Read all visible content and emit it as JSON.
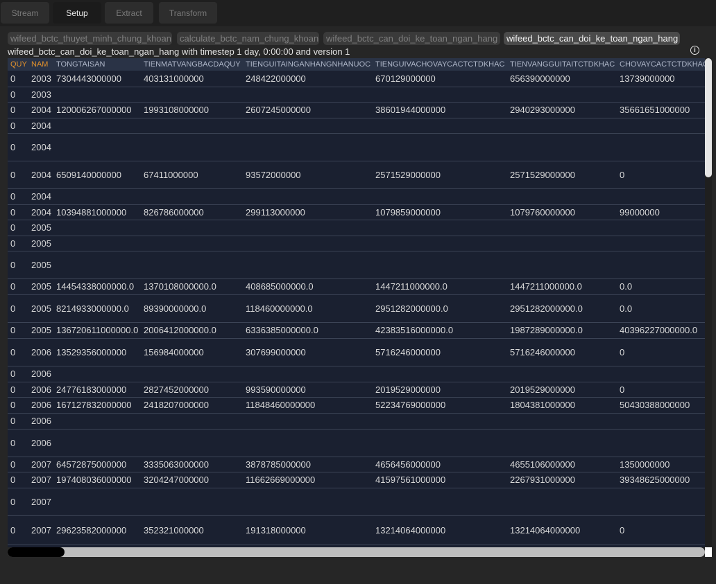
{
  "tabs": [
    "Stream",
    "Setup",
    "Extract",
    "Transform"
  ],
  "active_tab": "Setup",
  "chips": [
    "wifeed_bctc_thuyet_minh_chung_khoan",
    "calculate_bctc_nam_chung_khoan",
    "wifeed_bctc_can_doi_ke_toan_ngan_hang",
    "wifeed_bctc_can_doi_ke_toan_ngan_hang"
  ],
  "subtitle": "wifeed_bctc_can_doi_ke_toan_ngan_hang with timestep 1 day, 0:00:00 and version 1",
  "info_icon": "info-icon",
  "table": {
    "columns": [
      "QUY",
      "NAM",
      "TONGTAISAN",
      "TIENMATVANGBACDAQUY",
      "TIENGUITAINGANHANGNHANUOC",
      "TIENGUIVACHOVAYCACTCTDKHAC",
      "TIENVANGGUITAITCTDKHAC",
      "CHOVAYCACTCTDKHAC"
    ],
    "highlight_columns": [
      "QUY",
      "NAM"
    ],
    "rows": [
      [
        "0",
        "2003",
        "7304443000000",
        "403131000000",
        "248422000000",
        "670129000000",
        "656390000000",
        "13739000000"
      ],
      [
        "0",
        "2003",
        "",
        "",
        "",
        "",
        "",
        ""
      ],
      [
        "0",
        "2004",
        "120006267000000",
        "1993108000000",
        "2607245000000",
        "38601944000000",
        "2940293000000",
        "35661651000000"
      ],
      [
        "0",
        "2004",
        "",
        "",
        "",
        "",
        "",
        ""
      ],
      [
        "0",
        "2004",
        "",
        "",
        "",
        "",
        "",
        ""
      ],
      [
        "0",
        "2004",
        "6509140000000",
        "67411000000",
        "93572000000",
        "2571529000000",
        "2571529000000",
        "0"
      ],
      [
        "0",
        "2004",
        "",
        "",
        "",
        "",
        "",
        ""
      ],
      [
        "0",
        "2004",
        "10394881000000",
        "826786000000",
        "299113000000",
        "1079859000000",
        "1079760000000",
        "99000000"
      ],
      [
        "0",
        "2005",
        "",
        "",
        "",
        "",
        "",
        ""
      ],
      [
        "0",
        "2005",
        "",
        "",
        "",
        "",
        "",
        ""
      ],
      [
        "0",
        "2005",
        "",
        "",
        "",
        "",
        "",
        ""
      ],
      [
        "0",
        "2005",
        "14454338000000.0",
        "1370108000000.0",
        "408685000000.0",
        "1447211000000.0",
        "1447211000000.0",
        "0.0"
      ],
      [
        "0",
        "2005",
        "8214933000000.0",
        "89390000000.0",
        "118460000000.0",
        "2951282000000.0",
        "2951282000000.0",
        "0.0"
      ],
      [
        "0",
        "2005",
        "136720611000000.0",
        "2006412000000.0",
        "6336385000000.0",
        "42383516000000.0",
        "1987289000000.0",
        "40396227000000.0"
      ],
      [
        "0",
        "2006",
        "13529356000000",
        "156984000000",
        "307699000000",
        "5716246000000",
        "5716246000000",
        "0"
      ],
      [
        "0",
        "2006",
        "",
        "",
        "",
        "",
        "",
        ""
      ],
      [
        "0",
        "2006",
        "24776183000000",
        "2827452000000",
        "993590000000",
        "2019529000000",
        "2019529000000",
        "0"
      ],
      [
        "0",
        "2006",
        "167127832000000",
        "2418207000000",
        "11848460000000",
        "52234769000000",
        "1804381000000",
        "50430388000000"
      ],
      [
        "0",
        "2006",
        "",
        "",
        "",
        "",
        "",
        ""
      ],
      [
        "0",
        "2006",
        "",
        "",
        "",
        "",
        "",
        ""
      ],
      [
        "0",
        "2007",
        "64572875000000",
        "3335063000000",
        "3878785000000",
        "4656456000000",
        "4655106000000",
        "1350000000"
      ],
      [
        "0",
        "2007",
        "197408036000000",
        "3204247000000",
        "11662669000000",
        "41597561000000",
        "2267931000000",
        "39348625000000"
      ],
      [
        "0",
        "2007",
        "",
        "",
        "",
        "",
        "",
        ""
      ],
      [
        "0",
        "2007",
        "29623582000000",
        "352321000000",
        "191318000000",
        "13214064000000",
        "13214064000000",
        "0"
      ]
    ]
  }
}
